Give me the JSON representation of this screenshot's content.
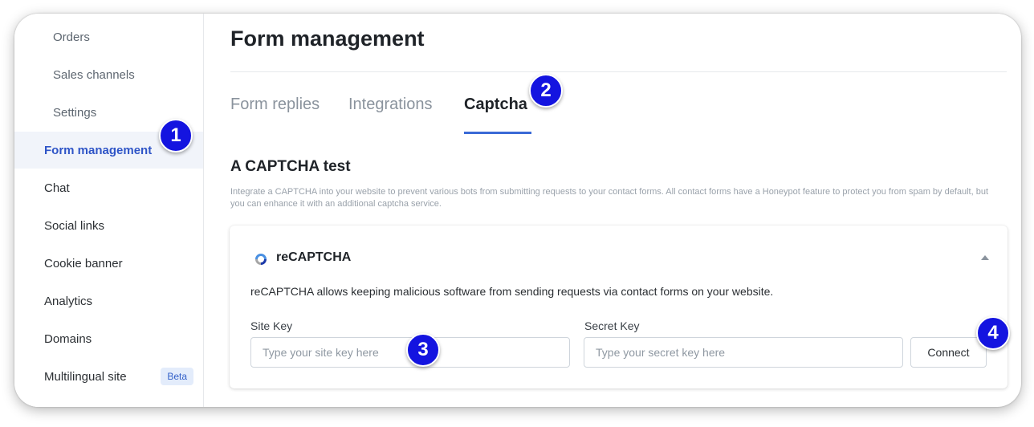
{
  "sidebar": {
    "items": [
      {
        "label": "Orders"
      },
      {
        "label": "Sales channels"
      },
      {
        "label": "Settings"
      },
      {
        "label": "Form management"
      },
      {
        "label": "Chat"
      },
      {
        "label": "Social links"
      },
      {
        "label": "Cookie banner"
      },
      {
        "label": "Analytics"
      },
      {
        "label": "Domains"
      },
      {
        "label": "Multilingual site",
        "badge": "Beta"
      }
    ]
  },
  "header": {
    "title": "Form management"
  },
  "tabs": [
    {
      "label": "Form replies"
    },
    {
      "label": "Integrations"
    },
    {
      "label": "Captcha"
    }
  ],
  "section": {
    "title": "A CAPTCHA test",
    "description": "Integrate a CAPTCHA into your website to prevent various bots from submitting requests to your contact forms. All contact forms have a Honeypot feature to protect you from spam by default, but you can enhance it with an additional captcha service."
  },
  "recaptcha": {
    "title": "reCAPTCHA",
    "description": "reCAPTCHA allows keeping malicious software from sending requests via contact forms on your website.",
    "site_key_label": "Site Key",
    "site_key_placeholder": "Type your site key here",
    "site_key_value": "",
    "secret_key_label": "Secret Key",
    "secret_key_placeholder": "Type your secret key here",
    "secret_key_value": "",
    "connect_label": "Connect"
  },
  "annotations": [
    "1",
    "2",
    "3",
    "4"
  ],
  "colors": {
    "accent": "#3a6ad6",
    "active_nav_text": "#2f55c7",
    "badge": "#1414e0"
  }
}
